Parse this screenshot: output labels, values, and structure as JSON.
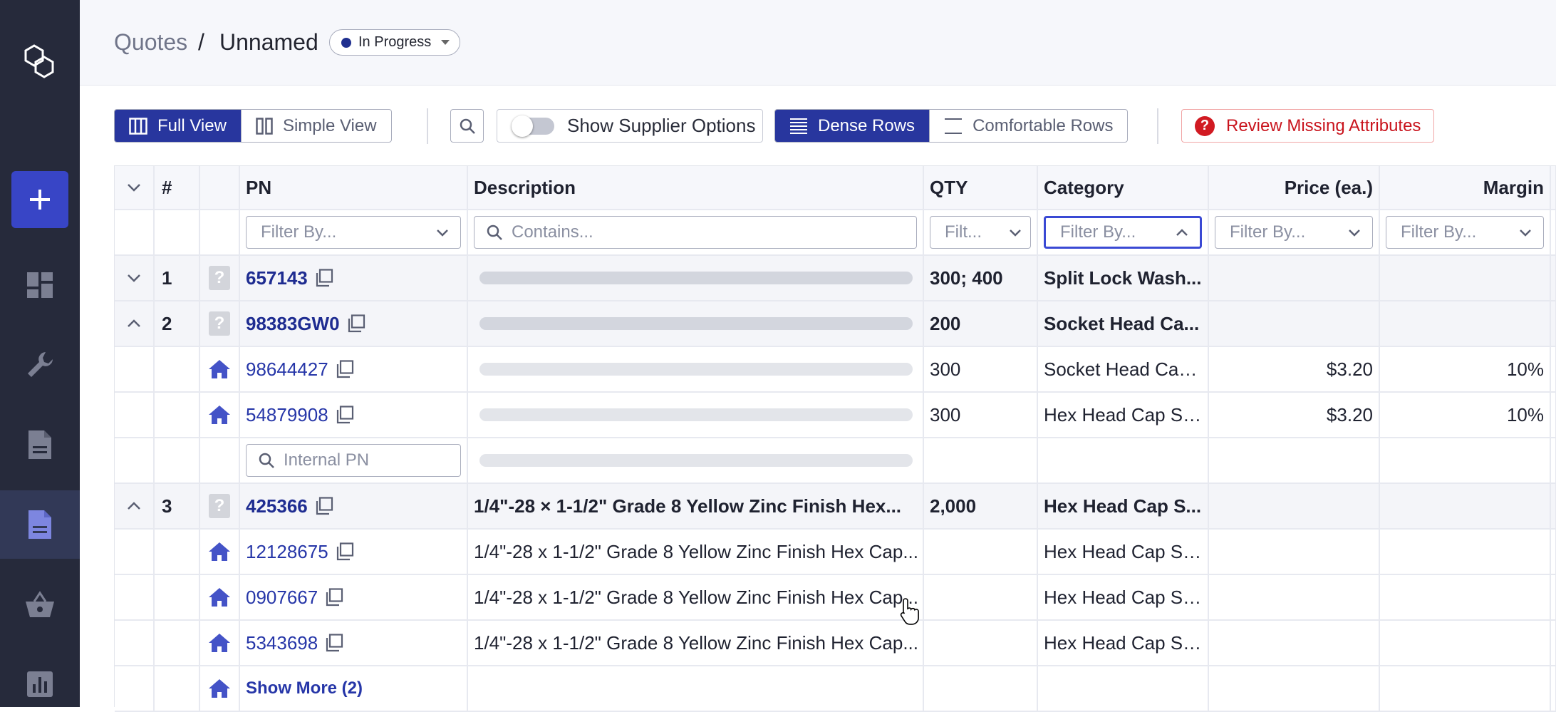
{
  "breadcrumb": {
    "parent": "Quotes",
    "separator": "/",
    "current": "Unnamed"
  },
  "status": {
    "label": "In Progress",
    "color": "#1f2f8f"
  },
  "toolbar": {
    "full_view": "Full View",
    "simple_view": "Simple View",
    "supplier_toggle": "Show Supplier Options",
    "dense_rows": "Dense Rows",
    "comfortable_rows": "Comfortable Rows",
    "review": "Review Missing Attributes"
  },
  "columns": {
    "num": "#",
    "pn": "PN",
    "description": "Description",
    "qty": "QTY",
    "category": "Category",
    "price": "Price (ea.)",
    "margin": "Margin"
  },
  "filters": {
    "pn": "Filter By...",
    "description": "Contains...",
    "qty": "Filt...",
    "category": "Filter By...",
    "price": "Filter By...",
    "margin": "Filter By..."
  },
  "rows": [
    {
      "num": "1",
      "pn": "657143",
      "qty": "300; 400",
      "category": "Split Lock Wash..."
    },
    {
      "num": "2",
      "pn": "98383GW0",
      "qty": "200",
      "category": "Socket Head Ca..."
    },
    {
      "pn": "98644427",
      "qty": "300",
      "category": "Socket Head Cap...",
      "price": "$3.20",
      "margin": "10%"
    },
    {
      "pn": "54879908",
      "qty": "300",
      "category": "Hex Head Cap Sc...",
      "price": "$3.20",
      "margin": "10%"
    },
    {
      "pn_placeholder": "Internal PN"
    },
    {
      "num": "3",
      "pn": "425366",
      "description": "1/4\"-28 × 1-1/2\" Grade 8 Yellow Zinc Finish Hex...",
      "qty": "2,000",
      "category": "Hex Head Cap S..."
    },
    {
      "pn": "12128675",
      "description": "1/4\"-28 x 1-1/2\" Grade 8 Yellow Zinc Finish Hex Cap...",
      "category": "Hex Head Cap Sc..."
    },
    {
      "pn": "0907667",
      "description": "1/4\"-28 x 1-1/2\" Grade 8 Yellow Zinc Finish Hex Cap...",
      "category": "Hex Head Cap Sc..."
    },
    {
      "pn": "5343698",
      "description": "1/4\"-28 x 1-1/2\" Grade 8 Yellow Zinc Finish Hex Cap...",
      "category": "Hex Head Cap Sc..."
    },
    {
      "show_more": "Show More (2)"
    }
  ],
  "icons": [
    "logo-icon",
    "plus-icon",
    "dashboard-icon",
    "wrench-icon",
    "document-icon",
    "quote-document-icon",
    "basket-icon",
    "chart-icon",
    "grid-columns-icon",
    "split-columns-icon",
    "search-icon",
    "dense-lines-icon",
    "comfortable-lines-icon",
    "question-circle-icon",
    "chevron-down-icon",
    "chevron-up-icon",
    "copy-icon",
    "home-icon",
    "question-mark-icon",
    "hand-cursor-icon"
  ],
  "colors": {
    "accent": "#28369e",
    "sidebar": "#262a3b",
    "danger": "#c9141d",
    "link": "#2636a8"
  }
}
